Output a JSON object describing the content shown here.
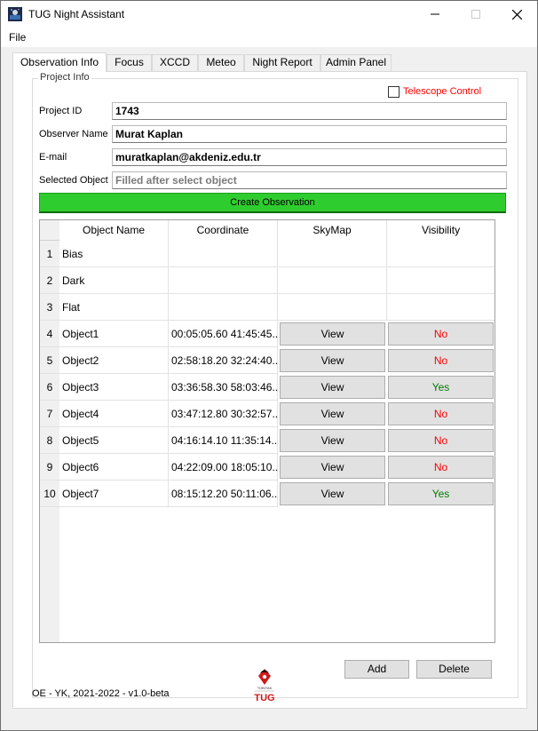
{
  "window": {
    "title": "TUG Night Assistant",
    "icon": "telescope-app-icon"
  },
  "menu": {
    "file": "File"
  },
  "tabs": [
    {
      "label": "Observation Info",
      "active": true
    },
    {
      "label": "Focus",
      "active": false
    },
    {
      "label": "XCCD",
      "active": false
    },
    {
      "label": "Meteo",
      "active": false
    },
    {
      "label": "Night Report",
      "active": false
    },
    {
      "label": "Admin Panel",
      "active": false
    }
  ],
  "project": {
    "group_title": "Project Info",
    "telescope_control_label": "Telescope Control",
    "telescope_control_checked": false,
    "project_id_label": "Project ID",
    "project_id": "1743",
    "observer_label": "Observer Name",
    "observer": "Murat Kaplan",
    "email_label": "E-mail",
    "email": "muratkaplan@akdeniz.edu.tr",
    "selected_label": "Selected Object",
    "selected_placeholder": "Filled after select object"
  },
  "create_button": "Create Observation",
  "table": {
    "headers": [
      "Object Name",
      "Coordinate",
      "SkyMap",
      "Visibility"
    ],
    "rows": [
      {
        "num": "1",
        "name": "Bias",
        "coord": "",
        "skymap": "",
        "visibility": ""
      },
      {
        "num": "2",
        "name": "Dark",
        "coord": "",
        "skymap": "",
        "visibility": ""
      },
      {
        "num": "3",
        "name": "Flat",
        "coord": "",
        "skymap": "",
        "visibility": ""
      },
      {
        "num": "4",
        "name": "Object1",
        "coord": "00:05:05.60 41:45:45....",
        "skymap": "View",
        "visibility": "No"
      },
      {
        "num": "5",
        "name": "Object2",
        "coord": "02:58:18.20 32:24:40....",
        "skymap": "View",
        "visibility": "No"
      },
      {
        "num": "6",
        "name": "Object3",
        "coord": "03:36:58.30 58:03:46....",
        "skymap": "View",
        "visibility": "Yes"
      },
      {
        "num": "7",
        "name": "Object4",
        "coord": "03:47:12.80 30:32:57....",
        "skymap": "View",
        "visibility": "No"
      },
      {
        "num": "8",
        "name": "Object5",
        "coord": "04:16:14.10 11:35:14....",
        "skymap": "View",
        "visibility": "No"
      },
      {
        "num": "9",
        "name": "Object6",
        "coord": "04:22:09.00 18:05:10....",
        "skymap": "View",
        "visibility": "No"
      },
      {
        "num": "10",
        "name": "Object7",
        "coord": "08:15:12.20 50:11:06....",
        "skymap": "View",
        "visibility": "Yes"
      }
    ]
  },
  "buttons": {
    "add": "Add",
    "delete": "Delete"
  },
  "footer": {
    "version": "OE - YK, 2021-2022 - v1.0-beta",
    "logo_text": "TUG",
    "logo_subtext": "TÜBİTAK"
  },
  "colors": {
    "create_button": "#2fcc2f",
    "telescope_label": "#ff0000",
    "visibility_no": "#ff0000",
    "visibility_yes": "#007a00"
  }
}
